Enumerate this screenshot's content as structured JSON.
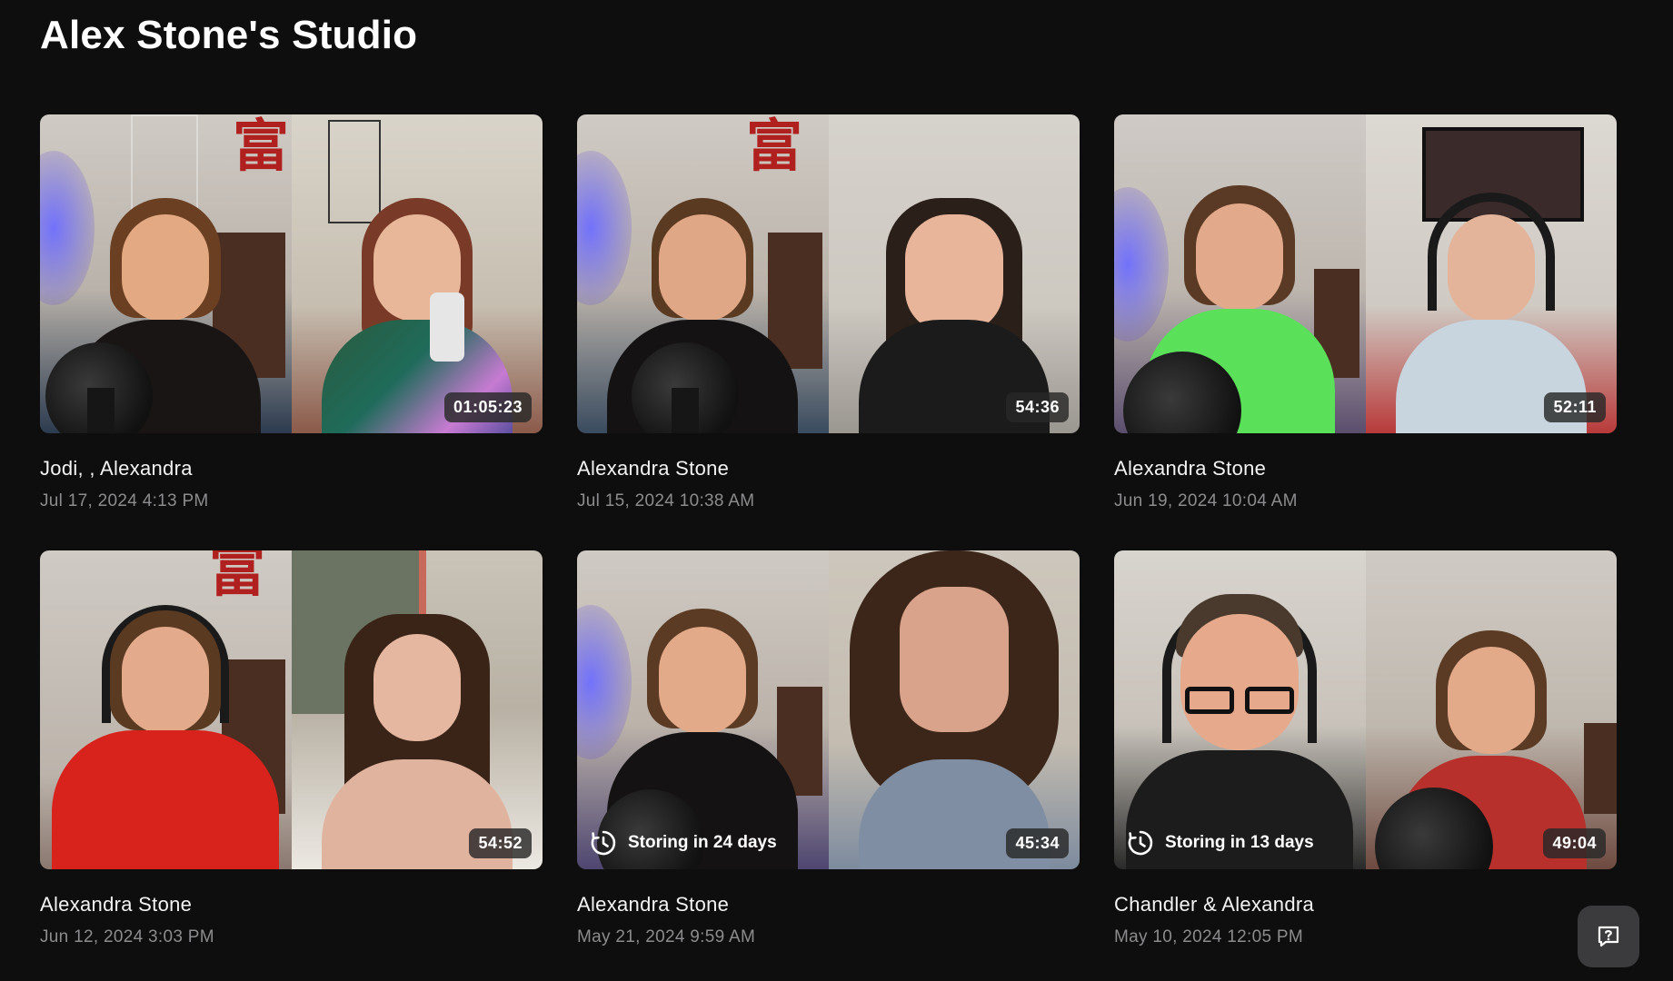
{
  "page": {
    "title": "Alex Stone's Studio"
  },
  "recordings": [
    {
      "title": "Jodi, , Alexandra",
      "date": "Jul 17, 2024 4:13 PM",
      "duration": "01:05:23",
      "storing": ""
    },
    {
      "title": "Alexandra Stone",
      "date": "Jul 15, 2024 10:38 AM",
      "duration": "54:36",
      "storing": ""
    },
    {
      "title": "Alexandra Stone",
      "date": "Jun 19, 2024 10:04 AM",
      "duration": "52:11",
      "storing": ""
    },
    {
      "title": "Alexandra Stone",
      "date": "Jun 12, 2024 3:03 PM",
      "duration": "54:52",
      "storing": ""
    },
    {
      "title": "Alexandra Stone",
      "date": "May 21, 2024 9:59 AM",
      "duration": "45:34",
      "storing": "Storing in 24 days"
    },
    {
      "title": "Chandler & Alexandra",
      "date": "May 10, 2024 12:05 PM",
      "duration": "49:04",
      "storing": "Storing in 13 days"
    }
  ],
  "icons": {
    "storing": "clock-icon",
    "help": "help-chat-icon"
  },
  "colors": {
    "background": "#0e0e0f",
    "date_text": "#8c8c8e",
    "duration_badge": "#282828",
    "help_button": "#3b3b3d"
  }
}
